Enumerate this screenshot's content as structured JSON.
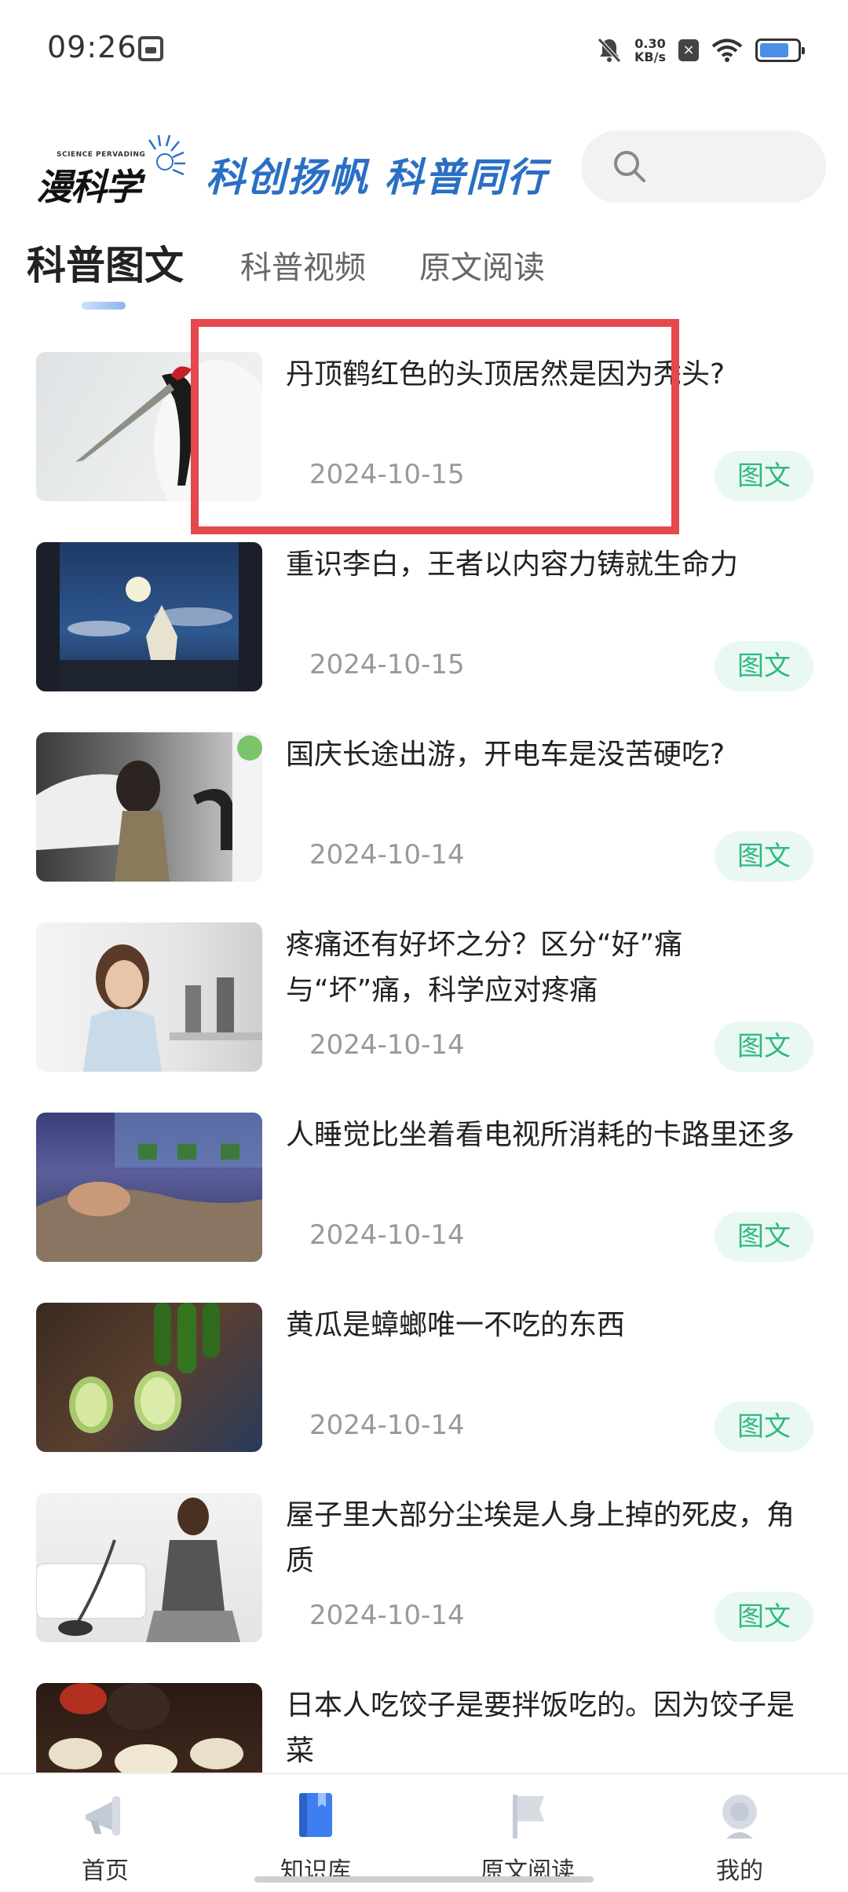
{
  "status_bar": {
    "time": "09:26",
    "net_speed_value": "0.30",
    "net_speed_unit": "KB/s",
    "icons": [
      "mute-icon",
      "close-box-icon",
      "wifi-icon",
      "battery-icon"
    ]
  },
  "header": {
    "logo_small": "SCIENCE PERVADING",
    "logo_main": "漫科学",
    "slogan": "科创扬帆 科普同行",
    "search_icon": "search-icon"
  },
  "tabs": [
    {
      "label": "科普图文",
      "active": true
    },
    {
      "label": "科普视频",
      "active": false
    },
    {
      "label": "原文阅读",
      "active": false
    }
  ],
  "articles": [
    {
      "title": "丹顶鹤红色的头顶居然是因为秃头?",
      "date": "2024-10-15",
      "badge": "图文"
    },
    {
      "title": "重识李白，王者以内容力铸就生命力",
      "date": "2024-10-15",
      "badge": "图文"
    },
    {
      "title": "国庆长途出游，开电车是没苦硬吃?",
      "date": "2024-10-14",
      "badge": "图文"
    },
    {
      "title": "疼痛还有好坏之分？区分“好”痛与“坏”痛，科学应对疼痛",
      "date": "2024-10-14",
      "badge": "图文"
    },
    {
      "title": "人睡觉比坐着看电视所消耗的卡路里还多",
      "date": "2024-10-14",
      "badge": "图文"
    },
    {
      "title": "黄瓜是蟑螂唯一不吃的东西",
      "date": "2024-10-14",
      "badge": "图文"
    },
    {
      "title": "屋子里大部分尘埃是人身上掉的死皮，角质",
      "date": "2024-10-14",
      "badge": "图文"
    },
    {
      "title": "日本人吃饺子是要拌饭吃的。因为饺子是菜",
      "date": "",
      "badge": ""
    }
  ],
  "bottom_nav": [
    {
      "label": "首页",
      "icon": "megaphone-icon",
      "active": false
    },
    {
      "label": "知识库",
      "icon": "book-icon",
      "active": true
    },
    {
      "label": "原文阅读",
      "icon": "flag-icon",
      "active": false
    },
    {
      "label": "我的",
      "icon": "profile-icon",
      "active": false
    }
  ],
  "colors": {
    "accent_blue": "#2a6fc4",
    "badge_green": "#2fb985",
    "badge_bg": "#eaf8f2",
    "highlight_red": "#e5484d"
  }
}
